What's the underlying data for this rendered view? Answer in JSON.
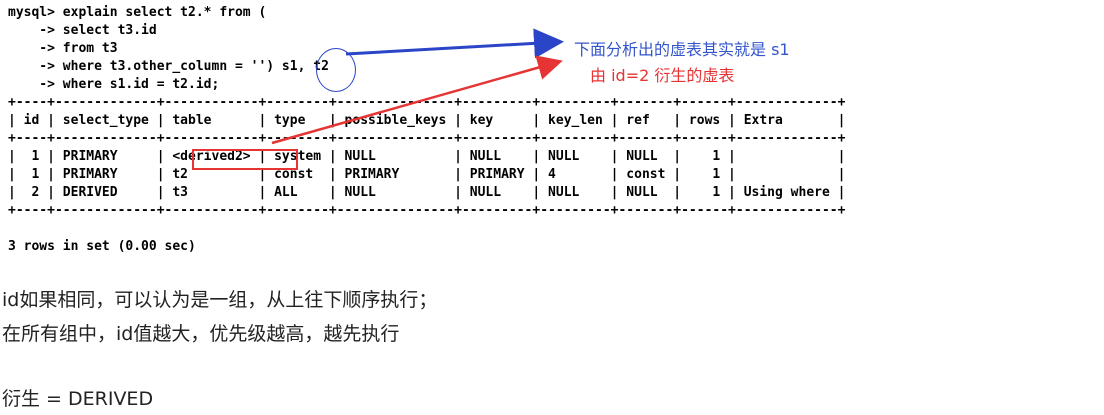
{
  "terminal": {
    "query_lines": [
      "mysql> explain select t2.* from (",
      "    -> select t3.id",
      "    -> from t3",
      "    -> where t3.other_column = '') s1, t2",
      "    -> where s1.id = t2.id;"
    ],
    "border_line": "+----+-------------+------------+--------+---------------+---------+---------+-------+------+-------------+",
    "header_row": "| id | select_type | table      | type   | possible_keys | key     | key_len | ref   | rows | Extra       |",
    "data_rows": [
      "|  1 | PRIMARY     | <derived2> | system | NULL          | NULL    | NULL    | NULL  |    1 |             |",
      "|  1 | PRIMARY     | t2         | const  | PRIMARY       | PRIMARY | 4       | const |    1 |             |",
      "|  2 | DERIVED     | t3         | ALL    | NULL          | NULL    | NULL    | NULL  |    1 | Using where |"
    ],
    "result_summary": "3 rows in set (0.00 sec)"
  },
  "annotations": {
    "blue_note": "下面分析出的虚表其实就是 s1",
    "red_note": "由 id=2 衍生的虚表",
    "blue_color": "#3355cc",
    "red_color": "#e63333"
  },
  "notes": {
    "line1": "id如果相同，可以认为是一组，从上往下顺序执行；",
    "line2": "在所有组中，id值越大，优先级越高，越先执行",
    "line3": "衍生 = DERIVED"
  }
}
